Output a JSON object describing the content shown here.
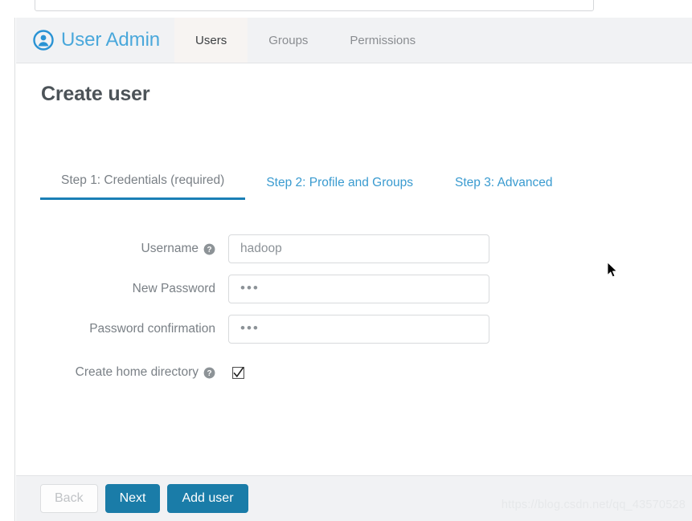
{
  "top_bar": {
    "search_placeholder": "",
    "search_value": "",
    "search_icon": "search-icon"
  },
  "header": {
    "brand_icon": "user-circle-icon",
    "brand_title": "User Admin",
    "tabs": [
      {
        "label": "Users",
        "active": true
      },
      {
        "label": "Groups",
        "active": false
      },
      {
        "label": "Permissions",
        "active": false
      }
    ]
  },
  "page": {
    "title": "Create user"
  },
  "steps": [
    {
      "label": "Step 1: Credentials (required)",
      "active": true
    },
    {
      "label": "Step 2: Profile and Groups",
      "active": false
    },
    {
      "label": "Step 3: Advanced",
      "active": false
    }
  ],
  "form": {
    "username": {
      "label": "Username",
      "help_icon": "question-circle-icon",
      "value": "hadoop",
      "placeholder": ""
    },
    "new_password": {
      "label": "New Password",
      "masked_value": "•••",
      "dot_count": 3
    },
    "password_confirmation": {
      "label": "Password confirmation",
      "masked_value": "•••",
      "dot_count": 3
    },
    "create_home_directory": {
      "label": "Create home directory",
      "help_icon": "question-circle-icon",
      "checked": true
    }
  },
  "footer": {
    "back_label": "Back",
    "back_disabled": true,
    "next_label": "Next",
    "add_user_label": "Add user"
  },
  "watermark": {
    "text": "https://blog.csdn.net/qq_43570528"
  },
  "colors": {
    "brand_blue": "#4aa8db",
    "link_blue": "#3a9bd0",
    "primary_button": "#1a7ca8",
    "active_underline": "#1a7fb5",
    "header_bg": "#f1f2f4",
    "active_tab_bg": "#f7f4f2",
    "label_gray": "#7a8086",
    "title_gray": "#4c5358"
  }
}
